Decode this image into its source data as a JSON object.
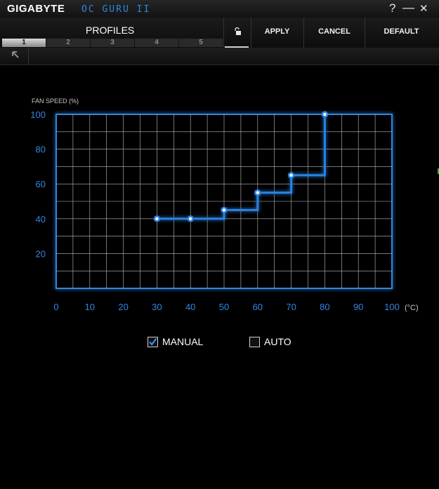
{
  "titlebar": {
    "brand": "GIGABYTE",
    "product": "OC GURU II",
    "help": "?",
    "minimize": "—",
    "close": "✕"
  },
  "toolbar": {
    "profiles_title": "PROFILES",
    "tabs": [
      "1",
      "2",
      "3",
      "4",
      "5"
    ],
    "active_tab": "1",
    "apply_label": "APPLY",
    "cancel_label": "CANCEL",
    "default_label": "DEFAULT"
  },
  "colors": {
    "accent": "#2f86e0",
    "curve": "#2a82e0",
    "grid": "#bdbdbd",
    "background": "#000000"
  },
  "mode": {
    "manual_label": "MANUAL",
    "manual_checked": true,
    "auto_label": "AUTO",
    "auto_checked": false
  },
  "chart_data": {
    "type": "line",
    "step": true,
    "ylabel": "FAN SPEED (%)",
    "x_unit": "(°C)",
    "xlim": [
      0,
      100
    ],
    "ylim": [
      0,
      100
    ],
    "xticks": [
      0,
      10,
      20,
      30,
      40,
      50,
      60,
      70,
      80,
      90,
      100
    ],
    "yticks": [
      20,
      40,
      60,
      80,
      100
    ],
    "grid": true,
    "points": [
      {
        "x": 30,
        "y": 40
      },
      {
        "x": 40,
        "y": 40
      },
      {
        "x": 50,
        "y": 45
      },
      {
        "x": 60,
        "y": 55
      },
      {
        "x": 70,
        "y": 65
      },
      {
        "x": 80,
        "y": 100
      }
    ]
  }
}
